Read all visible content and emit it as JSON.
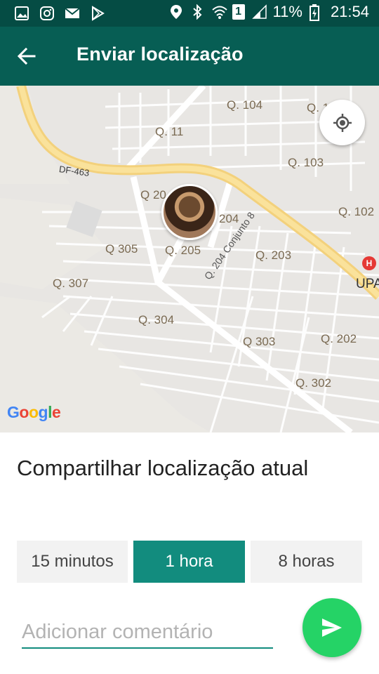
{
  "status_bar": {
    "battery": "11%",
    "time": "21:54",
    "sim_badge": "1",
    "left_icons": [
      "gallery-icon",
      "instagram-icon",
      "mail-icon",
      "play-store-icon"
    ],
    "right_icons": [
      "location-pin-icon",
      "bluetooth-icon",
      "wifi-icon",
      "signal-icon",
      "battery-icon"
    ]
  },
  "app_bar": {
    "title": "Enviar localização",
    "back_icon": "arrow-back-icon",
    "color": "#075e54"
  },
  "map": {
    "labels": [
      "Q. 104",
      "Q. 1",
      "Q. 11",
      "Q. 103",
      "DF-463",
      "Q 20",
      "204",
      "Q. 102",
      "Q 305",
      "Q. 205",
      "Q. 204 Conjunto 8",
      "Q. 203",
      "Q. 307",
      "Q. 304",
      "Q 303",
      "Q. 202",
      "Q. 302",
      "UPA"
    ],
    "hospital_marker": "H",
    "logo": {
      "g": "G",
      "o1": "o",
      "o2": "o",
      "g2": "g",
      "l": "l",
      "e": "e"
    }
  },
  "panel": {
    "heading": "Compartilhar localização atual",
    "durations": [
      "15 minutos",
      "1 hora",
      "8 horas"
    ],
    "selected_duration": "1 hora",
    "comment_placeholder": "Adicionar comentário",
    "accent": "#128c7e",
    "send_color": "#25d366"
  }
}
